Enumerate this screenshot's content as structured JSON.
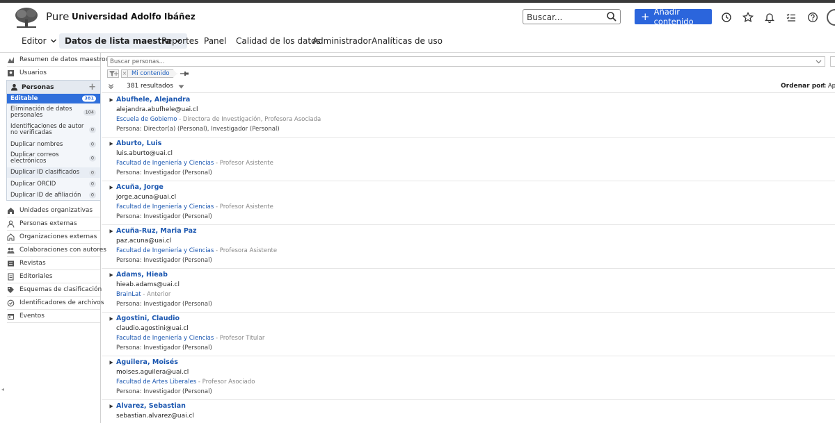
{
  "header": {
    "app_name": "Pure",
    "org_name": "Universidad Adolfo Ibáñez",
    "search_placeholder": "Buscar...",
    "add_content_label": "Añadir contenido"
  },
  "nav": {
    "items": [
      {
        "label": "Editor"
      },
      {
        "label": "Datos de lista maestra"
      },
      {
        "label": "Reportes"
      },
      {
        "label": "Panel"
      },
      {
        "label": "Calidad de los datos"
      },
      {
        "label": "Administrador"
      },
      {
        "label": "Analíticas de uso"
      }
    ]
  },
  "sidebar": {
    "top_items": [
      {
        "label": "Resumen de datos maestros",
        "icon": "chart-icon"
      },
      {
        "label": "Usuarios",
        "icon": "users-icon"
      }
    ],
    "personas": {
      "label": "Personas",
      "sub_items": [
        {
          "label": "Editable",
          "count": "381"
        },
        {
          "label": "Eliminación de datos personales",
          "count": "104"
        },
        {
          "label": "Identificaciones de autor no verificadas",
          "count": "0"
        },
        {
          "label": "Duplicar nombres",
          "count": "0"
        },
        {
          "label": "Duplicar correos electrónicos",
          "count": "0"
        },
        {
          "label": "Duplicar ID clasificados",
          "count": "0"
        },
        {
          "label": "Duplicar ORCID",
          "count": "0"
        },
        {
          "label": "Duplicar ID de afiliación",
          "count": "0"
        }
      ]
    },
    "bottom_items": [
      {
        "label": "Unidades organizativas",
        "icon": "org-units-icon"
      },
      {
        "label": "Personas externas",
        "icon": "external-person-icon"
      },
      {
        "label": "Organizaciones externas",
        "icon": "external-org-icon"
      },
      {
        "label": "Colaboraciones con autores",
        "icon": "collaboration-icon"
      },
      {
        "label": "Revistas",
        "icon": "journal-icon"
      },
      {
        "label": "Editoriales",
        "icon": "publisher-icon"
      },
      {
        "label": "Esquemas de clasificación",
        "icon": "tag-icon"
      },
      {
        "label": "Identificadores de archivos",
        "icon": "file-id-icon"
      },
      {
        "label": "Eventos",
        "icon": "events-icon"
      }
    ]
  },
  "content": {
    "filter_placeholder": "Buscar personas...",
    "chip_label": "Mi contenido",
    "results_count": "381 resultados",
    "order_label": "Ordenar por:",
    "order_value": "Ape",
    "persons": [
      {
        "name": "Abufhele, Alejandra",
        "email": "alejandra.abufhele@uai.cl",
        "unit": "Escuela de Gobierno",
        "position": " - Directora de Investigación, Profesora Asociada",
        "role": "Persona: Director(a) (Personal), Investigador (Personal)"
      },
      {
        "name": "Aburto, Luis",
        "email": "luis.aburto@uai.cl",
        "unit": "Facultad de Ingeniería y Ciencias",
        "position": " - Profesor Asistente",
        "role": "Persona: Investigador (Personal)"
      },
      {
        "name": "Acuña, Jorge",
        "email": "jorge.acuna@uai.cl",
        "unit": "Facultad de Ingeniería y Ciencias",
        "position": " - Profesor Asistente",
        "role": "Persona: Investigador (Personal)"
      },
      {
        "name": "Acuña-Ruz, Maria Paz",
        "email": "paz.acuna@uai.cl",
        "unit": "Facultad de Ingeniería y Ciencias",
        "position": " - Profesora Asistente",
        "role": "Persona: Investigador (Personal)"
      },
      {
        "name": "Adams, Hieab",
        "email": "hieab.adams@uai.cl",
        "unit": "BrainLat",
        "position": " - Anterior",
        "role": "Persona: Investigador (Personal)"
      },
      {
        "name": "Agostini, Claudio",
        "email": "claudio.agostini@uai.cl",
        "unit": "Facultad de Ingeniería y Ciencias",
        "position": " - Profesor Titular",
        "role": "Persona: Investigador (Personal)"
      },
      {
        "name": "Aguilera, Moisés",
        "email": "moises.aguilera@uai.cl",
        "unit": "Facultad de Artes Liberales",
        "position": " - Profesor Asociado",
        "role": "Persona: Investigador (Personal)"
      },
      {
        "name": "Alvarez, Sebastian",
        "email": "sebastian.alvarez@uai.cl",
        "unit": "",
        "position": "",
        "role": ""
      }
    ]
  }
}
